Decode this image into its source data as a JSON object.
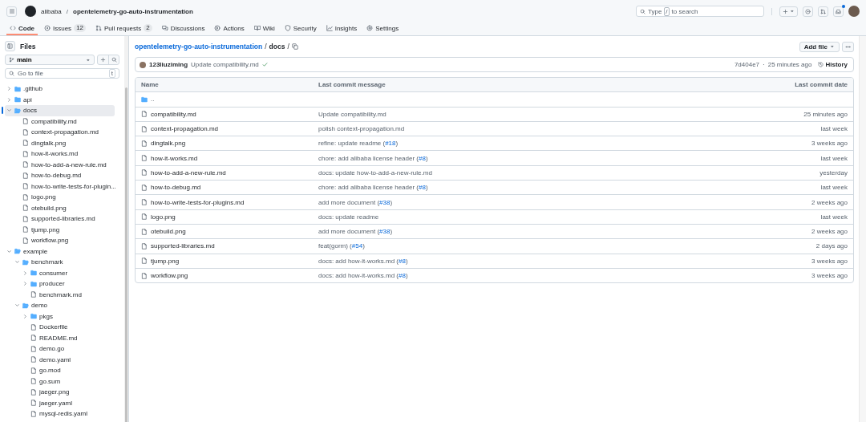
{
  "header": {
    "owner": "alibaba",
    "separator": "/",
    "repo": "opentelemetry-go-auto-instrumentation",
    "search": {
      "before": "Type",
      "key": "/",
      "after": "to search"
    },
    "notification_unread": true
  },
  "tabs": [
    {
      "kind": "code",
      "label": "Code",
      "selected": true
    },
    {
      "kind": "issues",
      "label": "Issues",
      "count": "12",
      "selected": false
    },
    {
      "kind": "pulls",
      "label": "Pull requests",
      "count": "2",
      "selected": false
    },
    {
      "kind": "discussions",
      "label": "Discussions",
      "selected": false
    },
    {
      "kind": "actions",
      "label": "Actions",
      "selected": false
    },
    {
      "kind": "wiki",
      "label": "Wiki",
      "selected": false
    },
    {
      "kind": "security",
      "label": "Security",
      "selected": false
    },
    {
      "kind": "insights",
      "label": "Insights",
      "selected": false
    },
    {
      "kind": "settings",
      "label": "Settings",
      "selected": false
    }
  ],
  "sidebar": {
    "title": "Files",
    "branch": "main",
    "goto_placeholder": "Go to file",
    "goto_key": "t",
    "tree": [
      {
        "kind": "folder",
        "name": ".github",
        "expanded": false,
        "selected": false
      },
      {
        "kind": "folder",
        "name": "api",
        "expanded": false,
        "selected": false
      },
      {
        "kind": "folder",
        "name": "docs",
        "expanded": true,
        "selected": true,
        "children": [
          {
            "kind": "file",
            "name": "compatibility.md",
            "selected": false
          },
          {
            "kind": "file",
            "name": "context-propagation.md",
            "selected": false
          },
          {
            "kind": "file",
            "name": "dingtalk.png",
            "selected": false
          },
          {
            "kind": "file",
            "name": "how-it-works.md",
            "selected": false
          },
          {
            "kind": "file",
            "name": "how-to-add-a-new-rule.md",
            "selected": false
          },
          {
            "kind": "file",
            "name": "how-to-debug.md",
            "selected": false
          },
          {
            "kind": "file",
            "name": "how-to-write-tests-for-plugin...",
            "selected": false
          },
          {
            "kind": "file",
            "name": "logo.png",
            "selected": false
          },
          {
            "kind": "file",
            "name": "otebuild.png",
            "selected": false
          },
          {
            "kind": "file",
            "name": "supported-libraries.md",
            "selected": false
          },
          {
            "kind": "file",
            "name": "tjump.png",
            "selected": false
          },
          {
            "kind": "file",
            "name": "workflow.png",
            "selected": false
          }
        ]
      },
      {
        "kind": "folder",
        "name": "example",
        "expanded": true,
        "selected": false,
        "children": [
          {
            "kind": "folder",
            "name": "benchmark",
            "expanded": true,
            "selected": false,
            "children": [
              {
                "kind": "folder",
                "name": "consumer",
                "expanded": false,
                "selected": false
              },
              {
                "kind": "folder",
                "name": "producer",
                "expanded": false,
                "selected": false
              },
              {
                "kind": "file",
                "name": "benchmark.md",
                "selected": false
              }
            ]
          },
          {
            "kind": "folder",
            "name": "demo",
            "expanded": true,
            "selected": false,
            "children": [
              {
                "kind": "folder",
                "name": "pkgs",
                "expanded": false,
                "selected": false
              },
              {
                "kind": "file",
                "name": "Dockerfile",
                "selected": false
              },
              {
                "kind": "file",
                "name": "README.md",
                "selected": false
              },
              {
                "kind": "file",
                "name": "demo.go",
                "selected": false
              },
              {
                "kind": "file",
                "name": "demo.yaml",
                "selected": false
              },
              {
                "kind": "file",
                "name": "go.mod",
                "selected": false
              },
              {
                "kind": "file",
                "name": "go.sum",
                "selected": false
              },
              {
                "kind": "file",
                "name": "jaeger.png",
                "selected": false
              },
              {
                "kind": "file",
                "name": "jaeger.yaml",
                "selected": false
              },
              {
                "kind": "file",
                "name": "mysql-redis.yaml",
                "selected": false
              }
            ]
          }
        ]
      }
    ]
  },
  "breadcrumb": {
    "repo": "opentelemetry-go-auto-instrumentation",
    "separator": "/",
    "folder": "docs",
    "trailing": "/"
  },
  "add_file": "Add file",
  "latest_commit": {
    "author": "123liuziming",
    "message": "Update compatibility.md",
    "hash": "7d404e7",
    "dot": "·",
    "time": "25 minutes ago",
    "history": "History"
  },
  "table": {
    "columns": [
      "Name",
      "Last commit message",
      "Last commit date"
    ],
    "rows": [
      {
        "kind": "parent",
        "name": ".."
      },
      {
        "kind": "file",
        "name": "compatibility.md",
        "message": [
          {
            "text": "Update compatibility.md",
            "link": false
          }
        ],
        "date": "25 minutes ago"
      },
      {
        "kind": "file",
        "name": "context-propagation.md",
        "message": [
          {
            "text": "polish context-propagation.md",
            "link": false
          }
        ],
        "date": "last week"
      },
      {
        "kind": "file",
        "name": "dingtalk.png",
        "message": [
          {
            "text": "refine: update readme (",
            "link": false
          },
          {
            "text": "#18",
            "link": true
          },
          {
            "text": ")",
            "link": false
          }
        ],
        "date": "3 weeks ago"
      },
      {
        "kind": "file",
        "name": "how-it-works.md",
        "message": [
          {
            "text": "chore: add alibaba license header (",
            "link": false
          },
          {
            "text": "#8",
            "link": true
          },
          {
            "text": ")",
            "link": false
          }
        ],
        "date": "last week"
      },
      {
        "kind": "file",
        "name": "how-to-add-a-new-rule.md",
        "message": [
          {
            "text": "docs: update how-to-add-a-new-rule.md",
            "link": false
          }
        ],
        "date": "yesterday"
      },
      {
        "kind": "file",
        "name": "how-to-debug.md",
        "message": [
          {
            "text": "chore: add alibaba license header (",
            "link": false
          },
          {
            "text": "#8",
            "link": true
          },
          {
            "text": ")",
            "link": false
          }
        ],
        "date": "last week"
      },
      {
        "kind": "file",
        "name": "how-to-write-tests-for-plugins.md",
        "message": [
          {
            "text": "add more document (",
            "link": false
          },
          {
            "text": "#38",
            "link": true
          },
          {
            "text": ")",
            "link": false
          }
        ],
        "date": "2 weeks ago"
      },
      {
        "kind": "file",
        "name": "logo.png",
        "message": [
          {
            "text": "docs: update readme",
            "link": false
          }
        ],
        "date": "last week"
      },
      {
        "kind": "file",
        "name": "otebuild.png",
        "message": [
          {
            "text": "add more document (",
            "link": false
          },
          {
            "text": "#38",
            "link": true
          },
          {
            "text": ")",
            "link": false
          }
        ],
        "date": "2 weeks ago"
      },
      {
        "kind": "file",
        "name": "supported-libraries.md",
        "message": [
          {
            "text": "feat(gorm) (",
            "link": false
          },
          {
            "text": "#54",
            "link": true
          },
          {
            "text": ")",
            "link": false
          }
        ],
        "date": "2 days ago"
      },
      {
        "kind": "file",
        "name": "tjump.png",
        "message": [
          {
            "text": "docs: add how-it-works.md (",
            "link": false
          },
          {
            "text": "#8",
            "link": true
          },
          {
            "text": ")",
            "link": false
          }
        ],
        "date": "3 weeks ago"
      },
      {
        "kind": "file",
        "name": "workflow.png",
        "message": [
          {
            "text": "docs: add how-it-works.md (",
            "link": false
          },
          {
            "text": "#8",
            "link": true
          },
          {
            "text": ")",
            "link": false
          }
        ],
        "date": "3 weeks ago"
      }
    ]
  }
}
